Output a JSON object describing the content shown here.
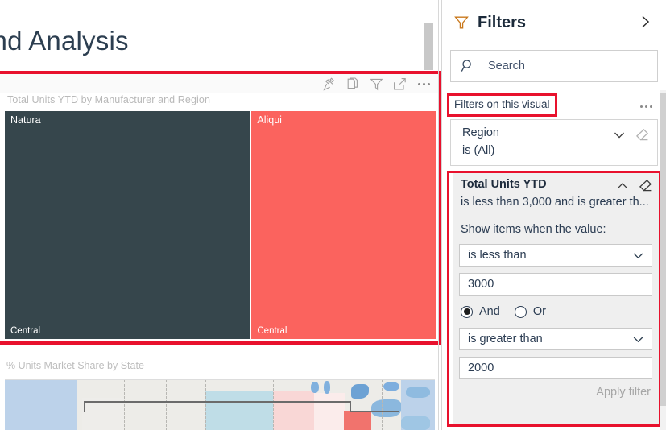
{
  "report": {
    "title": "end Analysis"
  },
  "treemap_visual": {
    "title": "Total Units YTD by Manufacturer and Region",
    "toolbar": [
      {
        "name": "pin-icon",
        "label": "Pin to dashboard"
      },
      {
        "name": "copy-icon",
        "label": "Copy visual"
      },
      {
        "name": "filter-icon",
        "label": "Filters and slicers affecting this visual"
      },
      {
        "name": "focus-mode-icon",
        "label": "Focus mode"
      },
      {
        "name": "more-options-icon",
        "label": "More options"
      }
    ],
    "highlight_color": "#e8112d"
  },
  "chart_data": {
    "type": "treemap",
    "title": "Total Units YTD by Manufacturer and Region",
    "group_label": "Manufacturer",
    "detail_label": "Region",
    "value_label": "Total Units YTD",
    "nodes": [
      {
        "manufacturer": "Natura",
        "region": "Central",
        "share_pct": 57,
        "color": "#36464c"
      },
      {
        "manufacturer": "Aliqui",
        "region": "Central",
        "share_pct": 43,
        "color": "#fb635e"
      }
    ],
    "legend": "none",
    "grid": false
  },
  "map_visual": {
    "title": "% Units Market Share by State",
    "type": "filled-map"
  },
  "filters_pane": {
    "title": "Filters",
    "funnel_icon": "filter-funnel-icon",
    "collapse_icon": "chevron-right-icon",
    "search": {
      "icon": "search-icon",
      "placeholder": "Search",
      "value": ""
    },
    "group_header": {
      "label": "Filters on this visual",
      "more_icon": "more-options-icon",
      "highlighted": true,
      "highlight_color": "#e8112d"
    },
    "cards": [
      {
        "name": "Region",
        "summary": "is (All)",
        "expanded": false,
        "chevron_icon": "chevron-down-icon",
        "clear_icon": "eraser-icon",
        "highlighted": false
      },
      {
        "name": "Total Units YTD",
        "summary": "is less than 3,000 and is greater th...",
        "expanded": true,
        "highlighted": true,
        "highlight_color": "#e8112d",
        "chevron_icon": "chevron-up-icon",
        "clear_icon": "eraser-icon",
        "prompt": "Show items when the value:",
        "condition1": {
          "operator": "is less than",
          "operator_chevron": "chevron-down-icon",
          "value": "3000"
        },
        "logic": {
          "options": [
            "And",
            "Or"
          ],
          "selected": "And"
        },
        "condition2": {
          "operator": "is greater than",
          "operator_chevron": "chevron-down-icon",
          "value": "2000"
        },
        "apply_label": "Apply filter",
        "apply_enabled": false
      }
    ]
  },
  "colors": {
    "highlight": "#e8112d",
    "treemap_dark": "#36464c",
    "treemap_red": "#fb635e",
    "accent_text": "#2b3c52",
    "funnel_orange": "#c9781b"
  }
}
